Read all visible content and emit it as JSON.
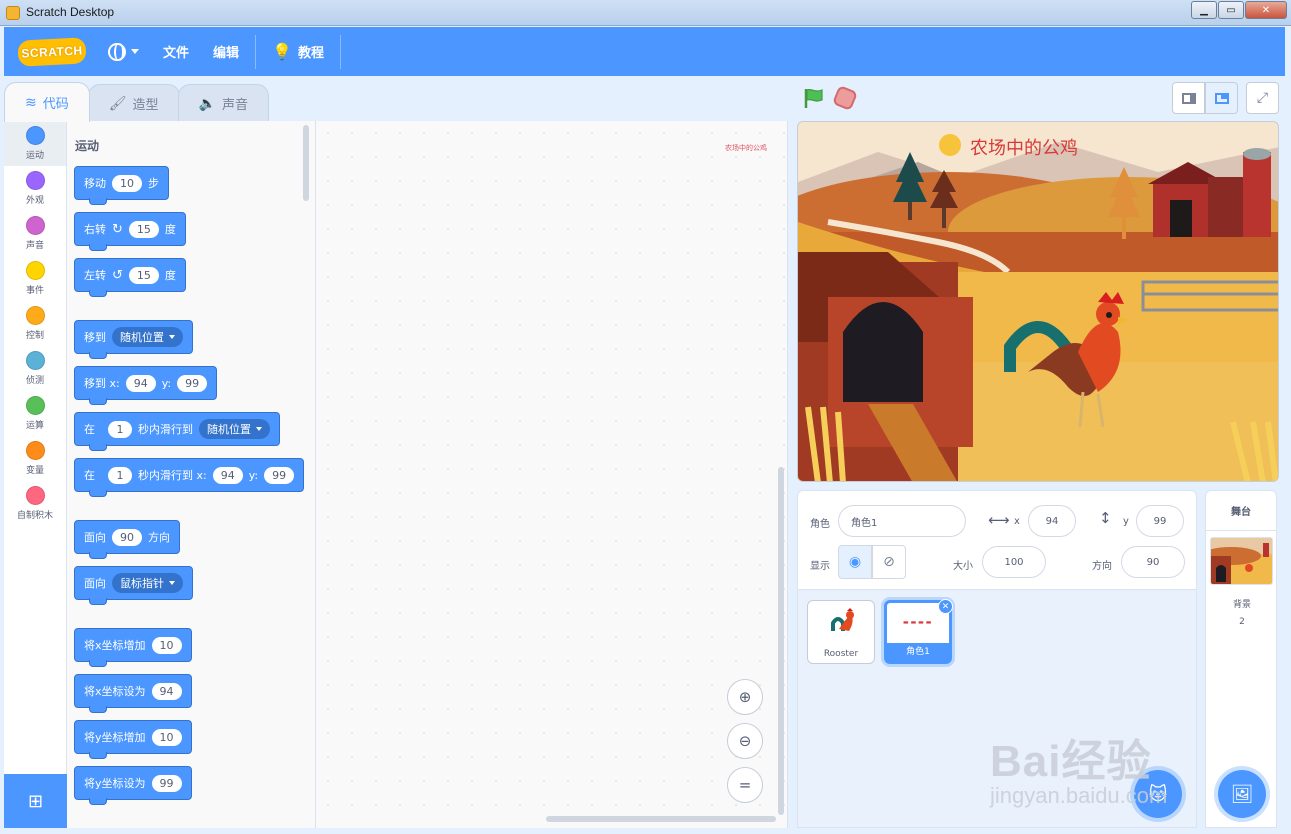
{
  "window": {
    "title": "Scratch Desktop"
  },
  "menubar": {
    "logo": "SCRATCH",
    "file": "文件",
    "edit": "编辑",
    "tutorials": "教程"
  },
  "tabs": [
    {
      "label": "代码",
      "icon": "code-icon"
    },
    {
      "label": "造型",
      "icon": "brush-icon"
    },
    {
      "label": "声音",
      "icon": "speaker-icon"
    }
  ],
  "categories": [
    {
      "label": "运动",
      "color": "#4c97ff"
    },
    {
      "label": "外观",
      "color": "#9966ff"
    },
    {
      "label": "声音",
      "color": "#cf63cf"
    },
    {
      "label": "事件",
      "color": "#ffd500"
    },
    {
      "label": "控制",
      "color": "#ffab19"
    },
    {
      "label": "侦测",
      "color": "#5cb1d6"
    },
    {
      "label": "运算",
      "color": "#59c059"
    },
    {
      "label": "变量",
      "color": "#ff8c1a"
    },
    {
      "label": "自制积木",
      "color": "#ff6680"
    }
  ],
  "palette": {
    "section": "运动",
    "move": {
      "a": "移动",
      "v": "10",
      "b": "步"
    },
    "turn_right": {
      "a": "右转",
      "v": "15",
      "b": "度"
    },
    "turn_left": {
      "a": "左转",
      "v": "15",
      "b": "度"
    },
    "goto": {
      "a": "移到",
      "d": "随机位置"
    },
    "goto_xy": {
      "a": "移到 x:",
      "x": "94",
      "yl": "y:",
      "y": "99"
    },
    "glide": {
      "a": "在",
      "v": "1",
      "b": "秒内滑行到",
      "d": "随机位置"
    },
    "glide_xy": {
      "a": "在",
      "v": "1",
      "b": "秒内滑行到 x:",
      "x": "94",
      "yl": "y:",
      "y": "99"
    },
    "point_dir": {
      "a": "面向",
      "v": "90",
      "b": "方向"
    },
    "point_to": {
      "a": "面向",
      "d": "鼠标指针"
    },
    "change_x": {
      "a": "将x坐标增加",
      "v": "10"
    },
    "set_x": {
      "a": "将x坐标设为",
      "v": "94"
    },
    "change_y": {
      "a": "将y坐标增加",
      "v": "10"
    },
    "set_y": {
      "a": "将y坐标设为",
      "v": "99"
    }
  },
  "script": {
    "hint": "农场中的公鸡"
  },
  "stage": {
    "title": "农场中的公鸡"
  },
  "sprite_info": {
    "sprite_label": "角色",
    "sprite_name": "角色1",
    "x_label": "x",
    "x": "94",
    "y_label": "y",
    "y": "99",
    "show_label": "显示",
    "size_label": "大小",
    "size": "100",
    "direction_label": "方向",
    "direction": "90"
  },
  "sprites": [
    {
      "name": "Rooster",
      "selected": false
    },
    {
      "name": "角色1",
      "selected": true
    }
  ],
  "stage_pane": {
    "header": "舞台",
    "backdrops_label": "背景",
    "backdrops_count": "2"
  },
  "watermark": {
    "brand": "Bai经验",
    "url": "jingyan.baidu.com"
  }
}
